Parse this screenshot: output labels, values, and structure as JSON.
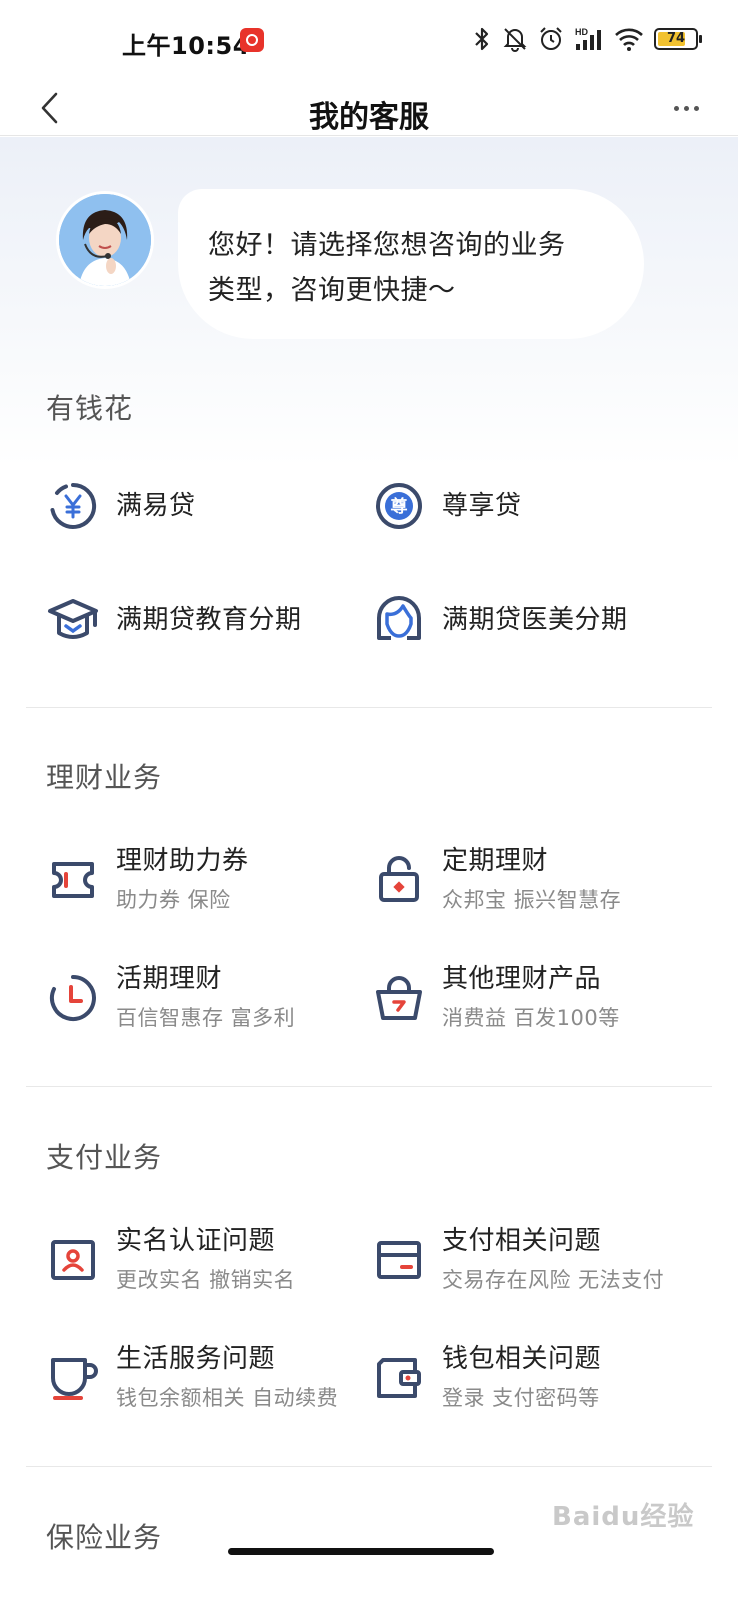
{
  "status_bar": {
    "time": "上午10:54",
    "hd_label": "HD",
    "battery": "74",
    "battery_level": 0.74,
    "icons": [
      "bluetooth-icon",
      "mute-bell-icon",
      "alarm-icon",
      "signal-icon",
      "wifi-icon",
      "battery-icon"
    ]
  },
  "nav": {
    "title": "我的客服"
  },
  "greeting": {
    "line1": "您好！请选择您想咨询的业务",
    "line2": "类型，咨询更快捷～"
  },
  "sections": [
    {
      "title": "有钱花",
      "items": [
        {
          "label": "满易贷",
          "icon": "yen-icon"
        },
        {
          "label": "尊享贷",
          "icon": "zun-icon",
          "icon_text": "尊"
        },
        {
          "label": "满期贷教育分期",
          "icon": "graduation-cap-icon"
        },
        {
          "label": "满期贷医美分期",
          "icon": "face-icon"
        }
      ]
    },
    {
      "title": "理财业务",
      "items": [
        {
          "label": "理财助力券",
          "sub": "助力券 保险",
          "icon": "ticket-icon"
        },
        {
          "label": "定期理财",
          "sub": "众邦宝 振兴智慧存",
          "icon": "lock-icon"
        },
        {
          "label": "活期理财",
          "sub": "百信智惠存 富多利",
          "icon": "clock-icon"
        },
        {
          "label": "其他理财产品",
          "sub": "消费益 百发100等",
          "icon": "basket-icon"
        }
      ]
    },
    {
      "title": "支付业务",
      "items": [
        {
          "label": "实名认证问题",
          "sub": "更改实名 撤销实名",
          "icon": "id-card-icon"
        },
        {
          "label": "支付相关问题",
          "sub": "交易存在风险 无法支付",
          "icon": "card-icon"
        },
        {
          "label": "生活服务问题",
          "sub": "钱包余额相关 自动续费",
          "icon": "cup-icon"
        },
        {
          "label": "钱包相关问题",
          "sub": "登录 支付密码等",
          "icon": "wallet-icon"
        }
      ]
    },
    {
      "title": "保险业务"
    }
  ],
  "watermark": "Baidu经验",
  "colors": {
    "icon_navy": "#3b4a6b",
    "icon_accent": "#e5443a",
    "icon_blue": "#3a6fd8",
    "section_title": "#555555",
    "subtext": "#8a8a8a"
  }
}
